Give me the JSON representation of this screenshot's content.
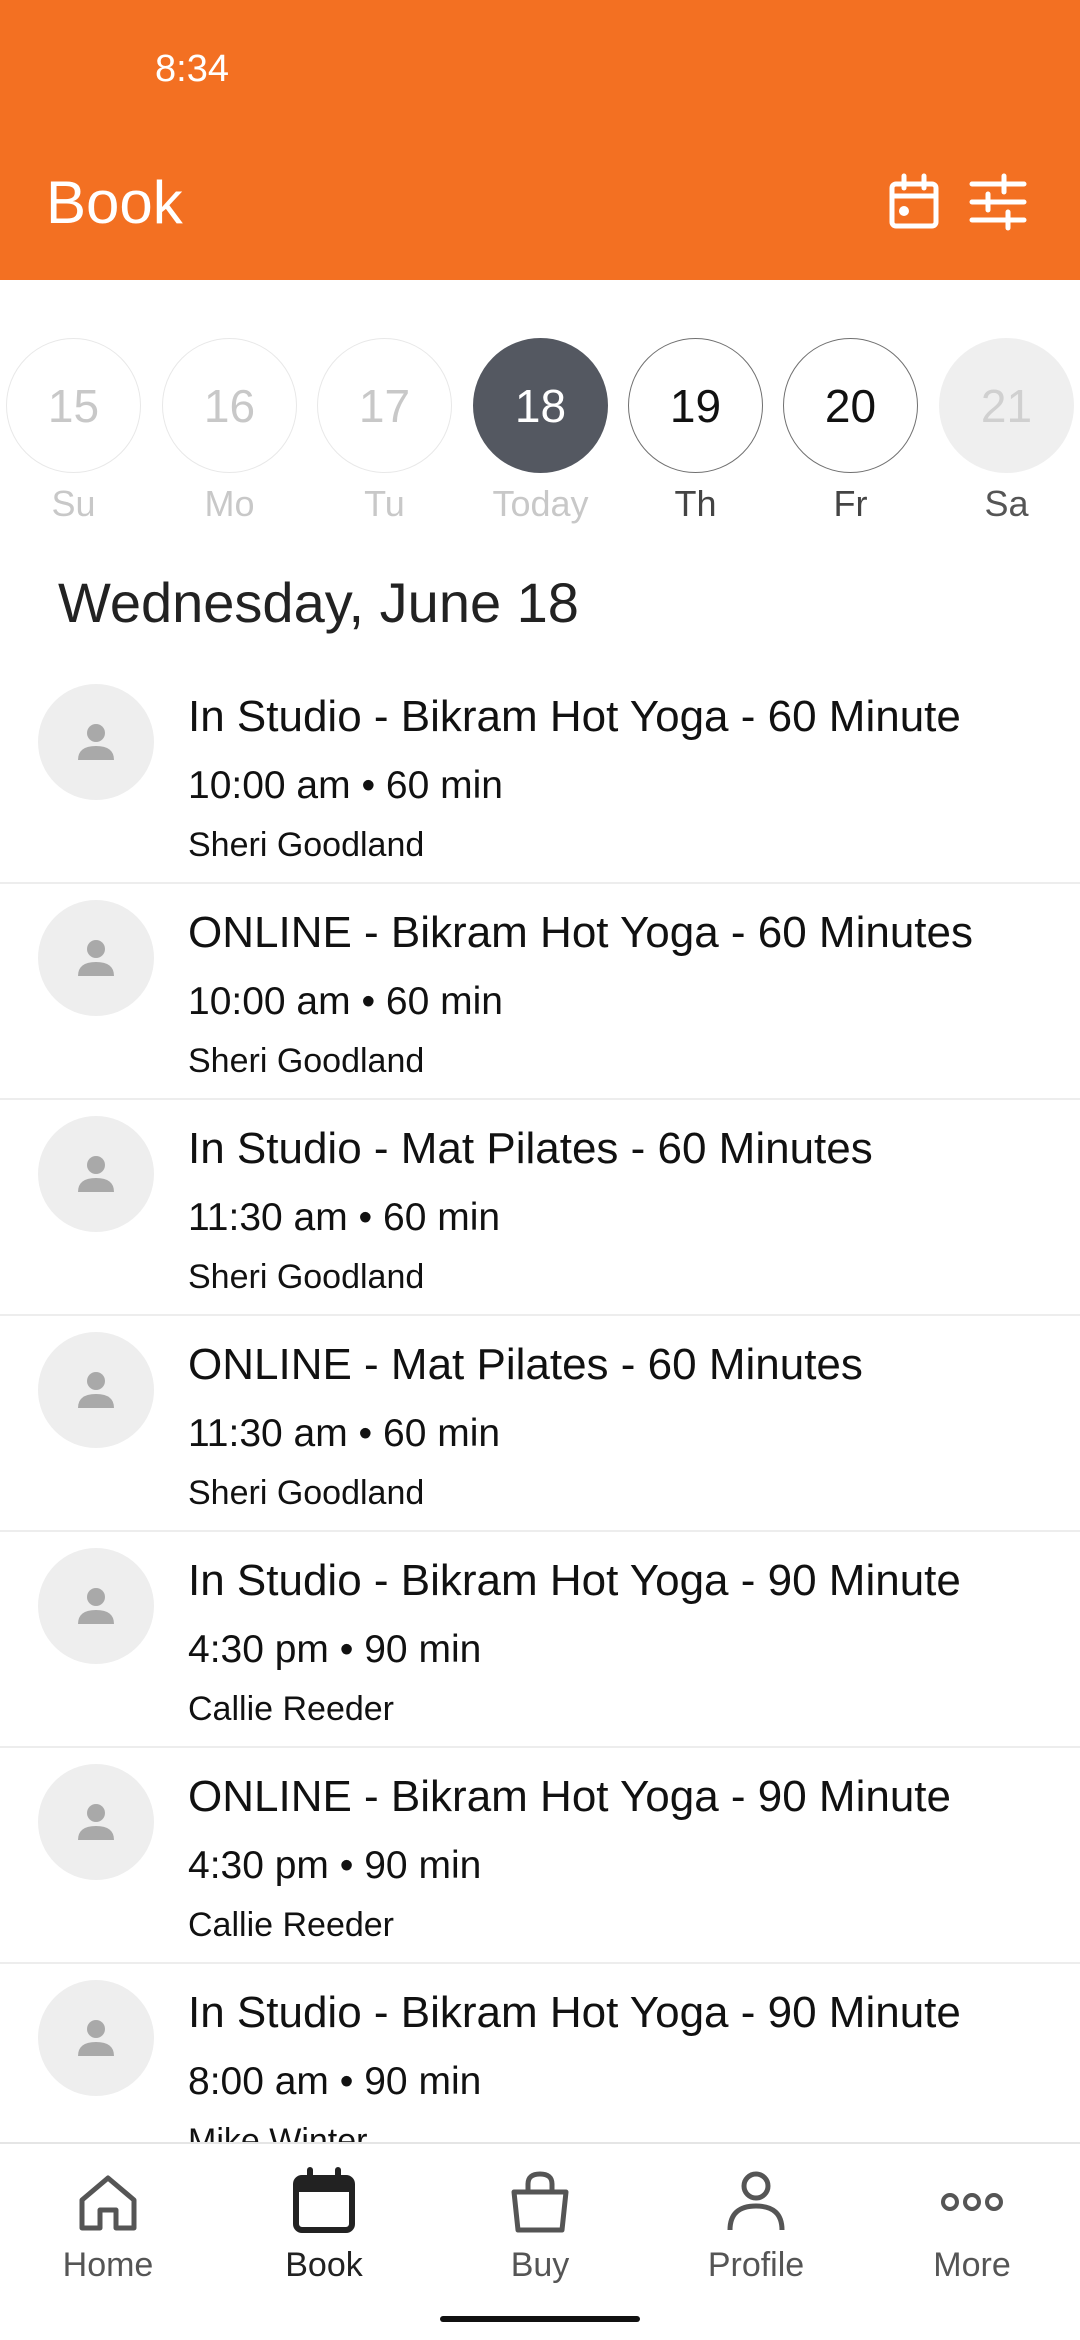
{
  "status_bar": {
    "time": "8:34"
  },
  "header": {
    "title": "Book",
    "icons": [
      "calendar-icon",
      "filter-sliders-icon"
    ]
  },
  "accent_color": "#f37022",
  "date_strip": {
    "days": [
      {
        "number": "15",
        "label": "Su"
      },
      {
        "number": "16",
        "label": "Mo"
      },
      {
        "number": "17",
        "label": "Tu"
      },
      {
        "number": "18",
        "label": "Today"
      },
      {
        "number": "19",
        "label": "Th"
      },
      {
        "number": "20",
        "label": "Fr"
      },
      {
        "number": "21",
        "label": "Sa"
      }
    ],
    "selected_index": 3
  },
  "date_heading": "Wednesday, June 18",
  "classes": [
    {
      "name": "In Studio - Bikram Hot Yoga - 60 Minute",
      "time": "10:00 am • 60 min",
      "instructor": "Sheri Goodland"
    },
    {
      "name": "ONLINE - Bikram Hot Yoga - 60 Minutes",
      "time": "10:00 am • 60 min",
      "instructor": "Sheri Goodland"
    },
    {
      "name": "In Studio - Mat Pilates - 60 Minutes",
      "time": "11:30 am • 60 min",
      "instructor": "Sheri Goodland"
    },
    {
      "name": "ONLINE - Mat Pilates - 60 Minutes",
      "time": "11:30 am • 60 min",
      "instructor": "Sheri Goodland"
    },
    {
      "name": "In Studio - Bikram Hot Yoga - 90 Minute",
      "time": "4:30 pm • 90 min",
      "instructor": "Callie Reeder"
    },
    {
      "name": "ONLINE - Bikram Hot Yoga - 90 Minute",
      "time": "4:30 pm • 90 min",
      "instructor": "Callie Reeder"
    },
    {
      "name": "In Studio - Bikram Hot Yoga - 90 Minute",
      "time": "8:00 am • 90 min",
      "instructor": "Mike Winter"
    }
  ],
  "bottom_nav": {
    "items": [
      {
        "label": "Home",
        "icon": "home-icon"
      },
      {
        "label": "Book",
        "icon": "calendar-icon"
      },
      {
        "label": "Buy",
        "icon": "shopping-bag-icon"
      },
      {
        "label": "Profile",
        "icon": "person-icon"
      },
      {
        "label": "More",
        "icon": "more-dots-icon"
      }
    ],
    "active": "Book"
  }
}
